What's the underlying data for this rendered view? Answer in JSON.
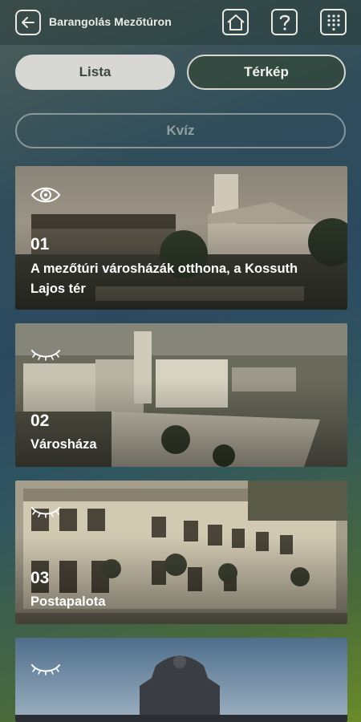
{
  "header": {
    "title": "Barangolás Mezőtúron",
    "back_icon": "back-arrow-icon",
    "home_icon": "home-icon",
    "help_icon": "question-mark-icon",
    "grid_icon": "dial-grid-icon"
  },
  "tabs": {
    "list_label": "Lista",
    "map_label": "Térkép",
    "active": "Lista"
  },
  "quiz": {
    "label": "Kvíz"
  },
  "items": [
    {
      "number": "01",
      "name": "A mezőtúri városházák otthona, a Kossuth Lajos tér",
      "visited": true,
      "icon": "eye-open-icon"
    },
    {
      "number": "02",
      "name": "Városháza",
      "visited": false,
      "icon": "eye-closed-icon"
    },
    {
      "number": "03",
      "name": "Postapalota",
      "visited": false,
      "icon": "eye-closed-icon"
    },
    {
      "number": "",
      "name": "",
      "visited": false,
      "icon": "eye-closed-icon"
    }
  ],
  "colors": {
    "active_tab_bg": "#d7d8d3",
    "active_tab_text": "#3b4640",
    "accent_border": "#d6d8d0"
  }
}
